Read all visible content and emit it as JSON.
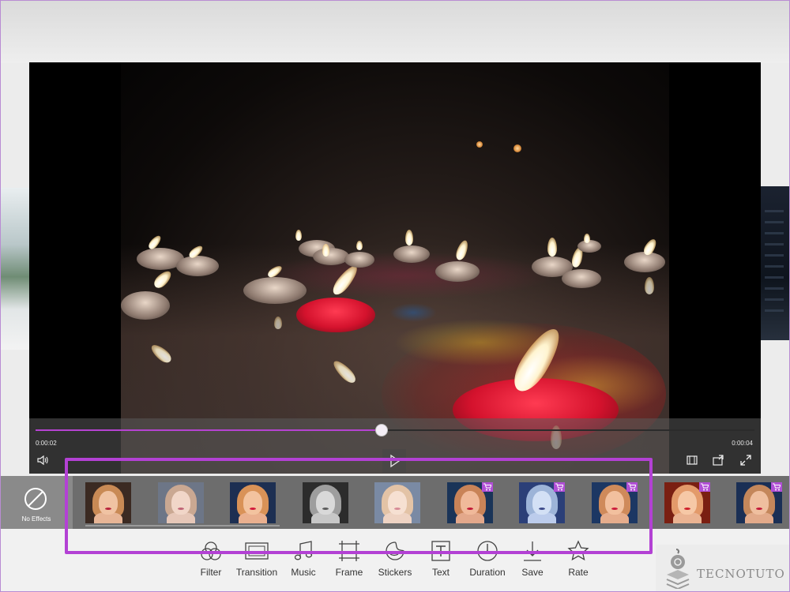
{
  "player": {
    "current_time": "0:00:02",
    "total_time": "0:00:04",
    "progress": 0.48
  },
  "effects": {
    "no_effects_label": "No Effects",
    "items": [
      {
        "name": "original",
        "premium": false,
        "bg": "#3b2a22",
        "hair": "#c98a55",
        "face": "#f0c3a3",
        "body": "#e7b596",
        "lips": "#b8233b"
      },
      {
        "name": "faded",
        "premium": false,
        "bg": "#6d7687",
        "hair": "#caa892",
        "face": "#f1d6c8",
        "body": "#e6c7b8",
        "lips": "#c06475"
      },
      {
        "name": "vivid",
        "premium": false,
        "bg": "#1d2f52",
        "hair": "#d99257",
        "face": "#f3c39f",
        "body": "#eab08f",
        "lips": "#d3193a"
      },
      {
        "name": "grayscale",
        "premium": false,
        "bg": "#2c2c2c",
        "hair": "#9e9e9e",
        "face": "#d9d9d9",
        "body": "#c7c7c7",
        "lips": "#5c5c5c"
      },
      {
        "name": "washed",
        "premium": false,
        "bg": "#7a8aa4",
        "hair": "#e3c3a6",
        "face": "#f6e0d2",
        "body": "#eed3c3",
        "lips": "#d68a96"
      },
      {
        "name": "cool",
        "premium": true,
        "bg": "#1a3458",
        "hair": "#c98358",
        "face": "#f0b99a",
        "body": "#e3a88b",
        "lips": "#c21837"
      },
      {
        "name": "blue",
        "premium": true,
        "bg": "#2b3f78",
        "hair": "#9db4d8",
        "face": "#d3e0f5",
        "body": "#bcccec",
        "lips": "#3d4a8a"
      },
      {
        "name": "warm-blue",
        "premium": true,
        "bg": "#1c3763",
        "hair": "#cf8a5a",
        "face": "#f2c09e",
        "body": "#e6ad8c",
        "lips": "#cc1c3c"
      },
      {
        "name": "red",
        "premium": true,
        "bg": "#7a1f12",
        "hair": "#e39a6a",
        "face": "#f6c8a6",
        "body": "#eab392",
        "lips": "#cf1f2a"
      },
      {
        "name": "deep",
        "premium": true,
        "bg": "#1a2f55",
        "hair": "#c4875b",
        "face": "#efbf9f",
        "body": "#e2aa8a",
        "lips": "#c21838"
      }
    ]
  },
  "toolbar": {
    "filter": "Filter",
    "transition": "Transition",
    "music": "Music",
    "frame": "Frame",
    "stickers": "Stickers",
    "text": "Text",
    "duration": "Duration",
    "save": "Save",
    "rate": "Rate"
  },
  "watermark": {
    "text": "TECNOTUTO"
  },
  "colors": {
    "accent": "#b341d4",
    "strip_bg": "#6d6d6d",
    "toolbar_bg": "#f1f1f1"
  }
}
